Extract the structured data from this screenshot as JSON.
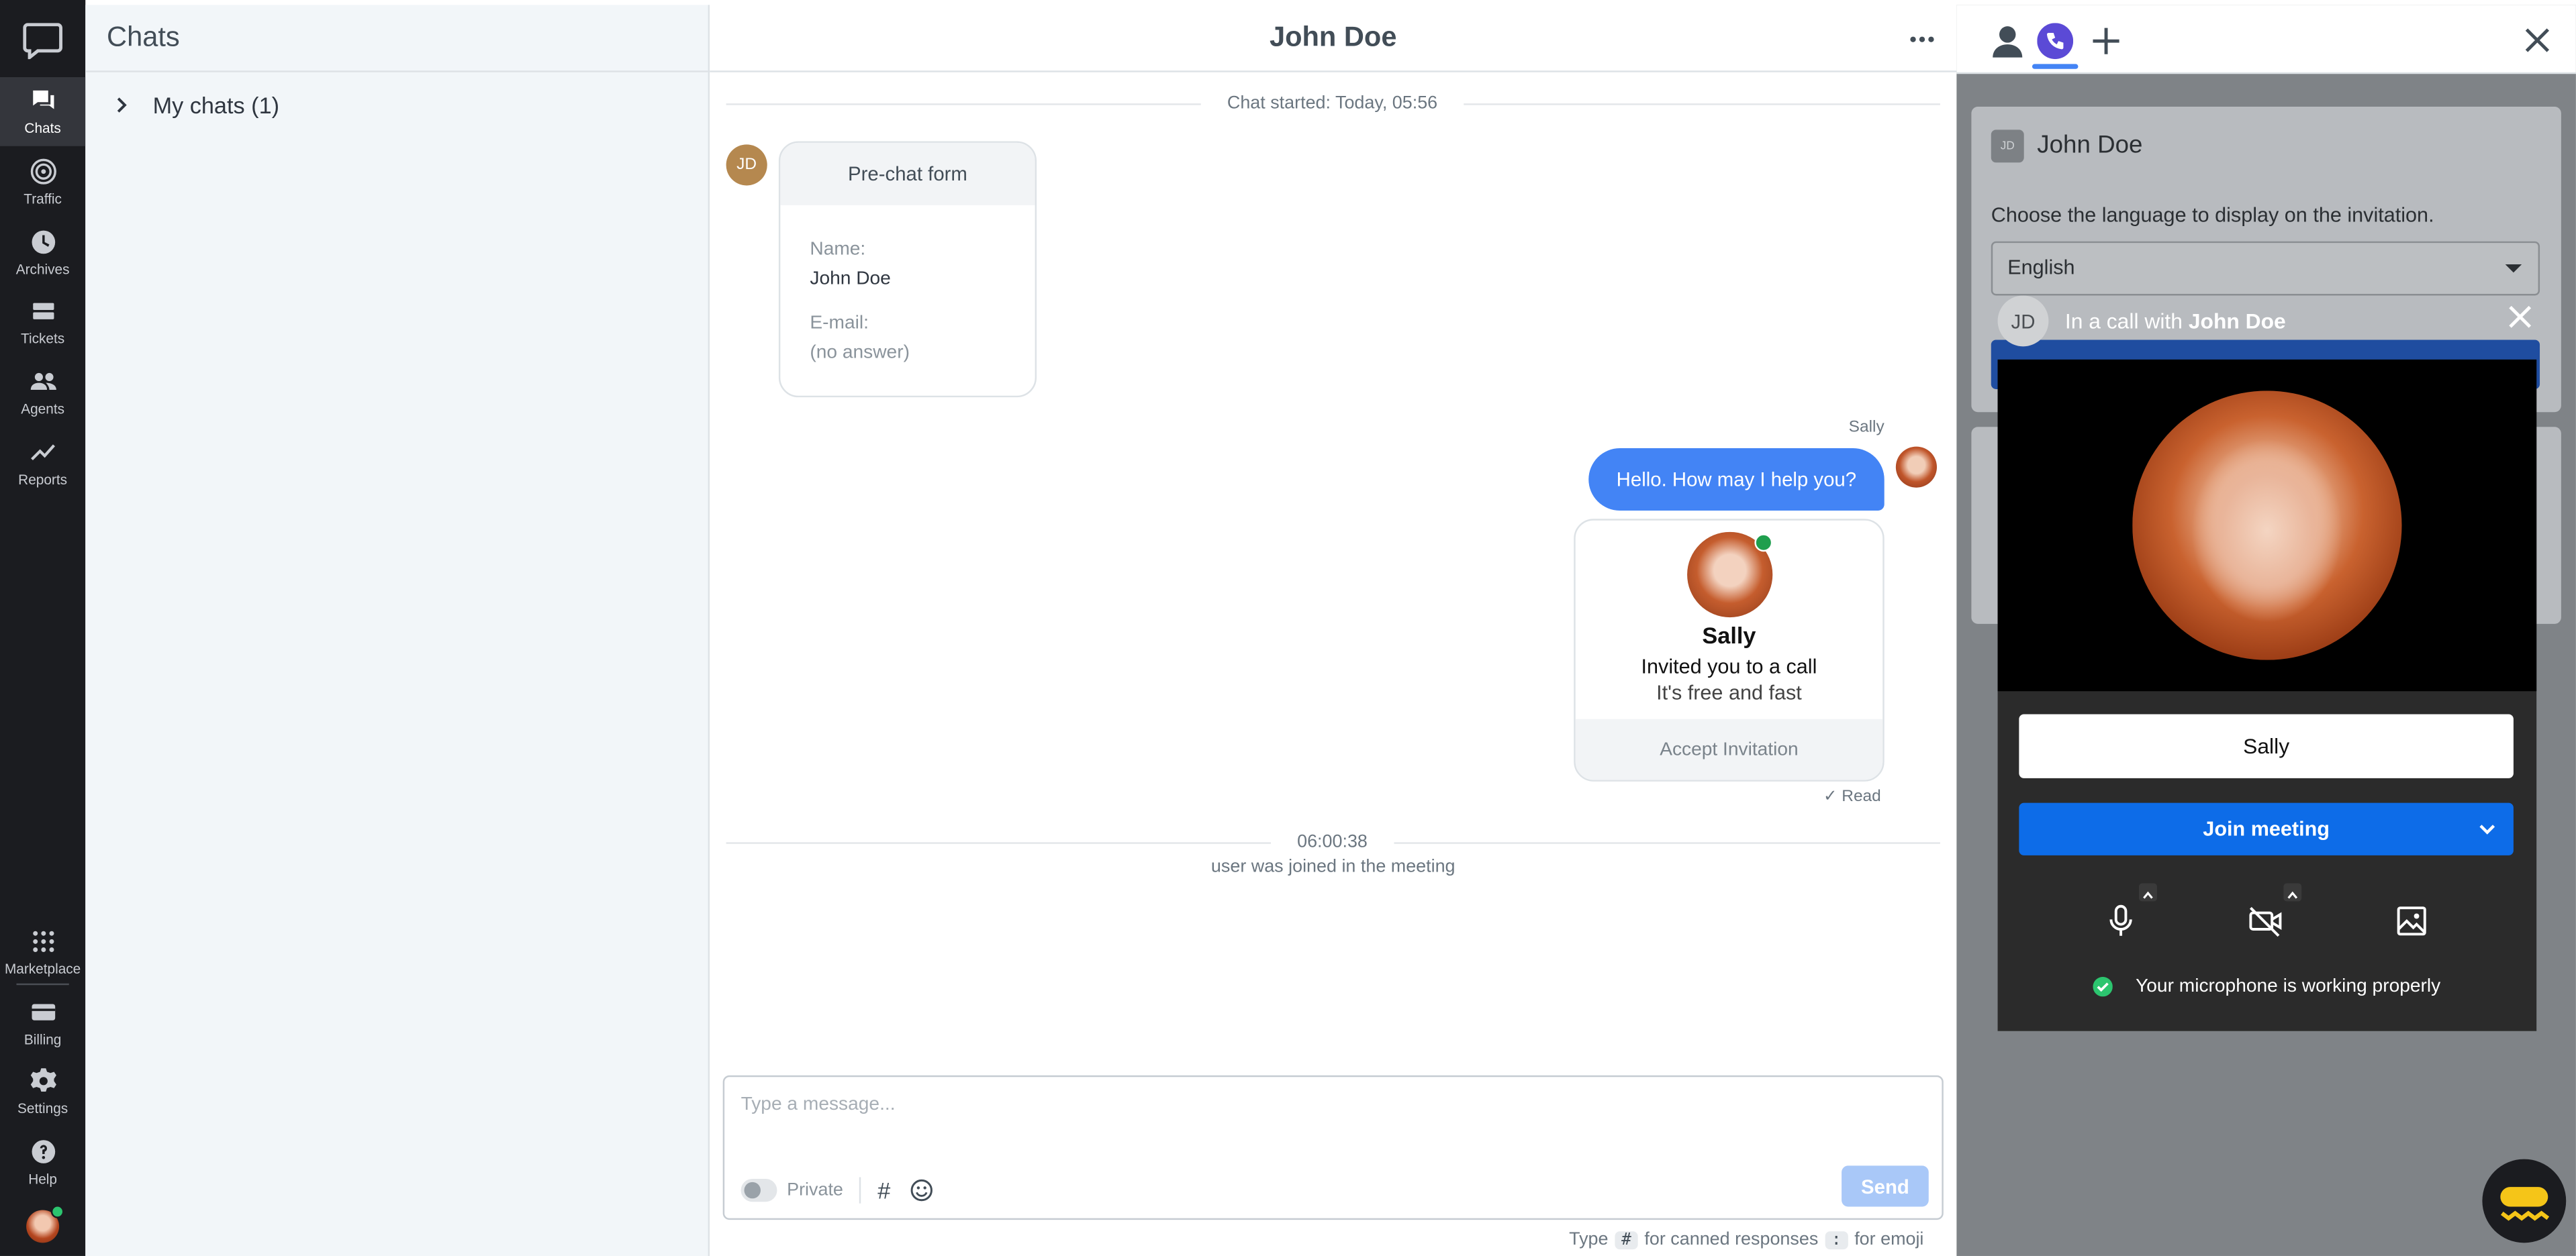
{
  "nav": {
    "items": [
      {
        "label": "Chats",
        "icon": "chat-icon"
      },
      {
        "label": "Traffic",
        "icon": "traffic-icon"
      },
      {
        "label": "Archives",
        "icon": "clock-icon"
      },
      {
        "label": "Tickets",
        "icon": "ticket-icon"
      },
      {
        "label": "Agents",
        "icon": "agents-icon"
      },
      {
        "label": "Reports",
        "icon": "reports-icon"
      }
    ],
    "bottom_items": [
      {
        "label": "Marketplace",
        "icon": "grid-icon"
      },
      {
        "label": "Billing",
        "icon": "billing-icon"
      },
      {
        "label": "Settings",
        "icon": "gear-icon"
      },
      {
        "label": "Help",
        "icon": "help-icon"
      }
    ]
  },
  "chat_list": {
    "title": "Chats",
    "group_label": "My chats (1)"
  },
  "chat": {
    "title": "John Doe",
    "started": "Chat started: Today, 05:56",
    "customer_initials": "JD",
    "prechat": {
      "title": "Pre-chat form",
      "name_label": "Name:",
      "name_value": "John Doe",
      "email_label": "E-mail:",
      "email_value": "(no answer)"
    },
    "agent_name": "Sally",
    "agent_message": "Hello. How may I help you?",
    "invitation": {
      "name": "Sally",
      "line1": "Invited you to a call",
      "line2": "It's free and fast",
      "accept": "Accept Invitation"
    },
    "read_status": "✓ Read",
    "event_time": "06:00:38",
    "event_text": "user was joined in the meeting"
  },
  "composer": {
    "placeholder": "Type a message...",
    "private_label": "Private",
    "send_label": "Send",
    "hint_type": "Type",
    "hint_hash": "#",
    "hint_canned": "for canned responses",
    "hint_colon": ":",
    "hint_emoji": "for emoji"
  },
  "right_panel": {
    "customer_initials": "JD",
    "customer_name": "John Doe",
    "language_prompt": "Choose the language to display on the invitation.",
    "language_selected": "English",
    "call_bar_initials": "JD",
    "call_bar_prefix": "In a call with",
    "call_bar_name": "John Doe",
    "meeting": {
      "name_value": "Sally",
      "join_label": "Join meeting",
      "mic_status": "Your microphone is working properly"
    }
  },
  "colors": {
    "accent": "#4384f5",
    "join_button": "#0d6ce8",
    "rail_bg": "#1b1c20",
    "online": "#2cc56f"
  }
}
